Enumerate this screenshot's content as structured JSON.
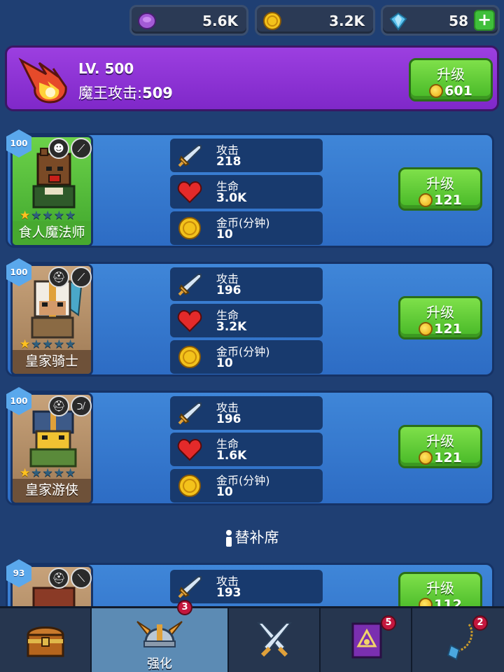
{
  "currencies": {
    "elixir": {
      "value": "5.6K",
      "icon": "purple-elixir-icon",
      "color": "#a35bd6"
    },
    "gold": {
      "value": "3.2K",
      "icon": "gold-coin-icon",
      "color": "#f3c21b"
    },
    "gems": {
      "value": "58",
      "icon": "gem-icon",
      "color": "#5fc4f0",
      "plus": "+"
    }
  },
  "boss": {
    "level": "LV. 500",
    "attack_label": "魔王攻击:",
    "attack_value": "509",
    "upgrade_label": "升级",
    "upgrade_cost": "601"
  },
  "heroes": [
    {
      "name": "食人魔法师",
      "level": "100",
      "stars_filled": 1,
      "stars_total": 5,
      "stats": {
        "attack_label": "攻击",
        "attack": "218",
        "health_label": "生命",
        "health": "3.0K",
        "gold_label": "金币(分钟)",
        "gold": "10"
      },
      "upgrade_label": "升级",
      "upgrade_cost": "121"
    },
    {
      "name": "皇家骑士",
      "level": "100",
      "stars_filled": 1,
      "stars_total": 5,
      "stats": {
        "attack_label": "攻击",
        "attack": "196",
        "health_label": "生命",
        "health": "3.2K",
        "gold_label": "金币(分钟)",
        "gold": "10"
      },
      "upgrade_label": "升级",
      "upgrade_cost": "121"
    },
    {
      "name": "皇家游侠",
      "level": "100",
      "stars_filled": 1,
      "stars_total": 5,
      "stats": {
        "attack_label": "攻击",
        "attack": "196",
        "health_label": "生命",
        "health": "1.6K",
        "gold_label": "金币(分钟)",
        "gold": "10"
      },
      "upgrade_label": "升级",
      "upgrade_cost": "121"
    }
  ],
  "bench": {
    "label": "替补席",
    "hero": {
      "level": "93",
      "attack_label": "攻击",
      "attack": "193",
      "upgrade_label": "升级",
      "upgrade_cost": "112"
    }
  },
  "nav": {
    "tabs": [
      {
        "icon": "treasure-chest-icon",
        "label": "",
        "badge": ""
      },
      {
        "icon": "winged-helmet-icon",
        "label": "强化",
        "badge": "3"
      },
      {
        "icon": "crossed-swords-icon",
        "label": "",
        "badge": ""
      },
      {
        "icon": "spellbook-icon",
        "label": "",
        "badge": "5"
      },
      {
        "icon": "amulet-icon",
        "label": "",
        "badge": "2"
      }
    ]
  }
}
